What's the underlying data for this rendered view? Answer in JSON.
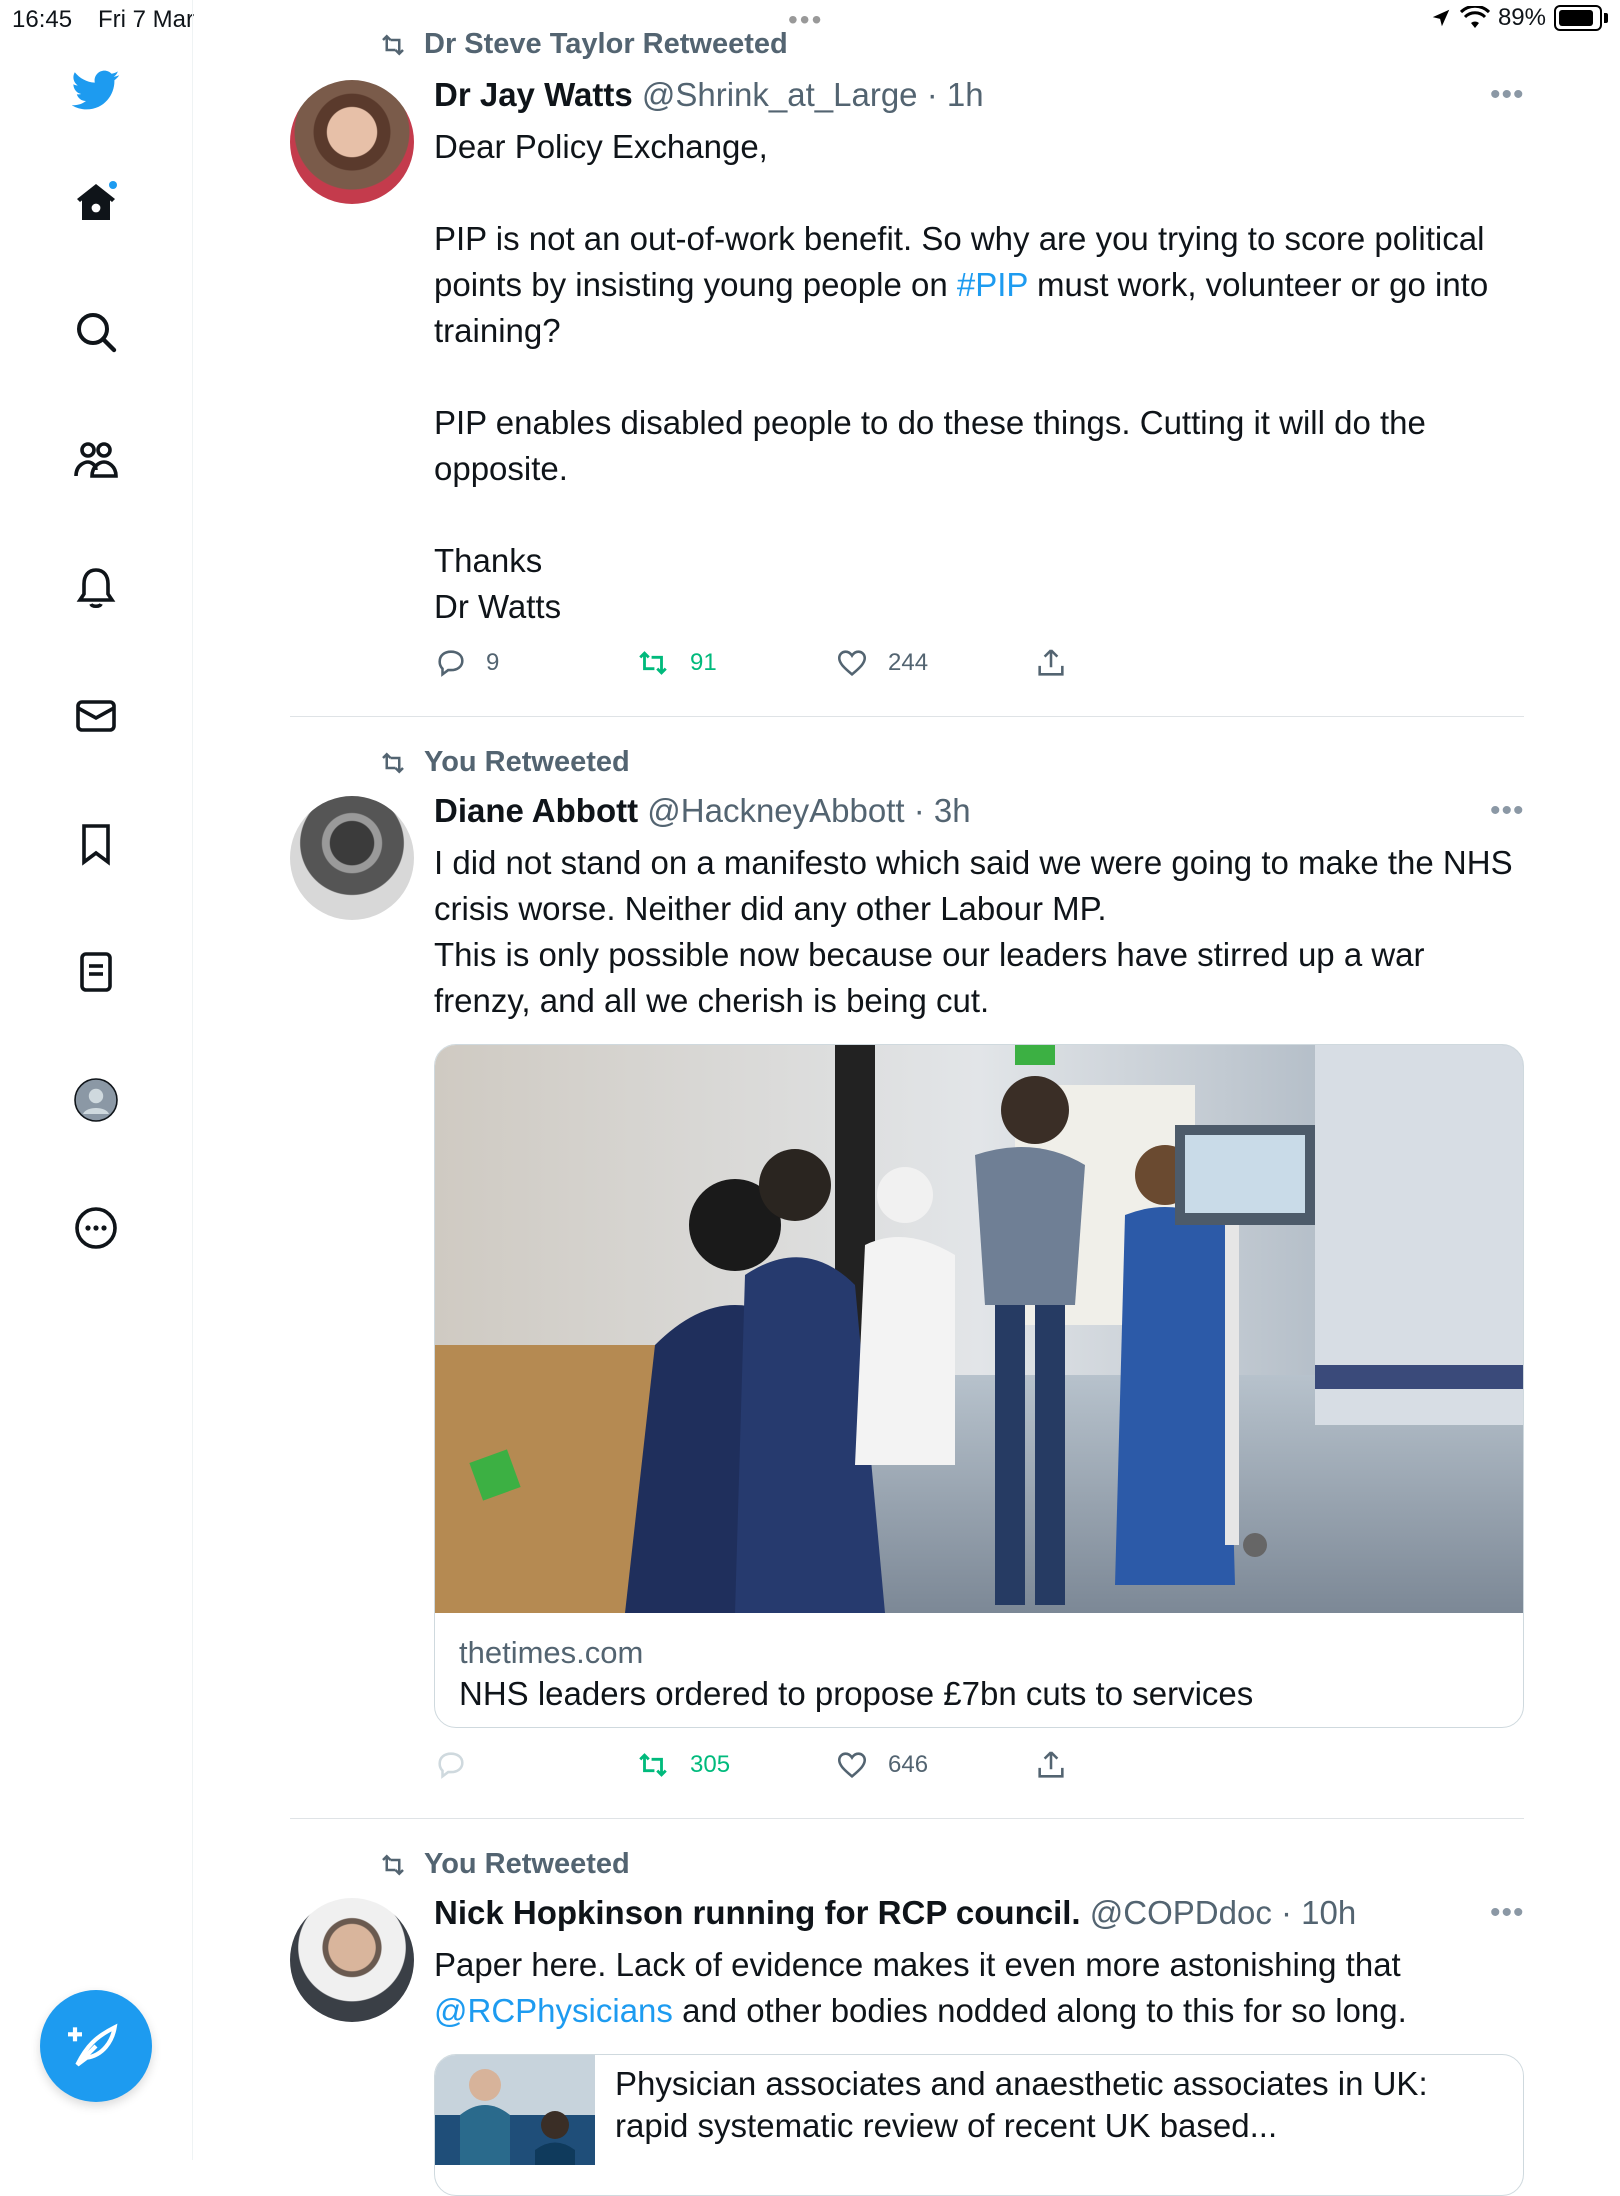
{
  "status_bar": {
    "time": "16:45",
    "date": "Fri 7 Mar",
    "battery": "89%"
  },
  "sidebar": {
    "items": [
      {
        "icon": "twitter-bird-icon"
      },
      {
        "icon": "home-icon"
      },
      {
        "icon": "search-icon"
      },
      {
        "icon": "communities-icon"
      },
      {
        "icon": "notifications-bell-icon"
      },
      {
        "icon": "messages-envelope-icon"
      },
      {
        "icon": "bookmark-icon"
      },
      {
        "icon": "lists-icon"
      },
      {
        "icon": "profile-avatar-icon"
      },
      {
        "icon": "more-circle-icon"
      }
    ],
    "compose": {
      "icon": "compose-feather-icon"
    },
    "accent": "#1d9bf0"
  },
  "tweets": [
    {
      "retweeted_by": "Dr Steve Taylor Retweeted",
      "name": "Dr Jay Watts",
      "handle": "@Shrink_at_Large",
      "time": "· 1h",
      "body": {
        "p1": "Dear Policy Exchange,",
        "p2a": "PIP is not an out-of-work benefit. So why are you trying to score political points by insisting young people on ",
        "p2_hashtag": "#PIP",
        "p2b": " must work, volunteer or go into training?",
        "p3": "PIP enables disabled people to do these things. Cutting it will do the opposite.",
        "p4": "Thanks",
        "p5": "Dr Watts"
      },
      "replies": "9",
      "retweets": "91",
      "likes": "244"
    },
    {
      "retweeted_by": "You Retweeted",
      "name": "Diane Abbott",
      "handle": "@HackneyAbbott",
      "time": "· 3h",
      "body": {
        "line1": "I did not stand on a manifesto which said we were going to make the NHS crisis worse. Neither did any other Labour MP.",
        "line2": "This is only possible now because our leaders have stirred up a war frenzy, and all we cherish is being cut."
      },
      "card": {
        "domain": "thetimes.com",
        "title": "NHS leaders ordered to propose £7bn cuts to services"
      },
      "retweets": "305",
      "likes": "646"
    },
    {
      "retweeted_by": "You Retweeted",
      "name": "Nick Hopkinson running for RCP council.",
      "handle": "@COPDdoc",
      "time": "· 10h",
      "body": {
        "t1": "Paper here. Lack of evidence makes it even more astonishing that ",
        "mention": "@RCPhysicians",
        "t2": " and other bodies nodded along to this for so long."
      },
      "card": {
        "title": "Physician associates and anaesthetic associates in UK: rapid systematic review of recent UK based..."
      }
    }
  ],
  "colors": {
    "accent": "#1d9bf0",
    "retweet_green": "#00ba7c",
    "muted": "#536471"
  }
}
